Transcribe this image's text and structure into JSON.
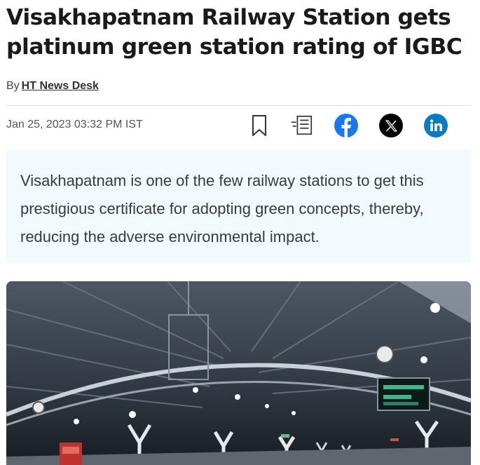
{
  "article": {
    "headline": "Visakhapatnam Railway Station gets platinum green station rating of IGBC",
    "byline_prefix": "By",
    "author": "HT News Desk",
    "timestamp": "Jan 25, 2023 03:32 PM IST",
    "summary": "Visakhapatnam is one of the few railway stations to get this prestigious certificate for adopting green concepts, thereby, reducing the adverse environmental impact."
  },
  "toolbar": {
    "icons": [
      "bookmark-icon",
      "read-mode-icon",
      "facebook-icon",
      "x-icon",
      "linkedin-icon"
    ]
  },
  "colors": {
    "facebook": "#1877f2",
    "x": "#000000",
    "linkedin": "#0a7bc0",
    "summary_bg": "#f1fafe"
  }
}
